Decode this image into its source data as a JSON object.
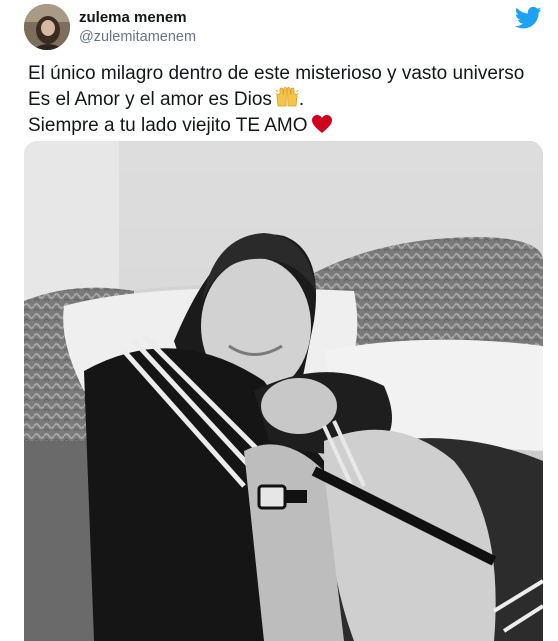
{
  "tweet": {
    "author": {
      "display_name": "zulema menem",
      "handle": "@zulemitamenem",
      "avatar_icon": "avatar-photo"
    },
    "brand": {
      "icon": "twitter-bird-icon",
      "color": "#1da1f2"
    },
    "text_lines": [
      "El único milagro dentro de este misterioso y vasto universo",
      "Es el Amor y el amor es Dios",
      ".",
      "Siempre a tu lado viejito TE AMO"
    ],
    "emojis": {
      "praise": "raising-hands-emoji",
      "heart": "red-heart-emoji",
      "heart_color": "#d0021b"
    },
    "media": {
      "type": "black-and-white photo",
      "content_icon": "photo-couple-embracing"
    }
  }
}
